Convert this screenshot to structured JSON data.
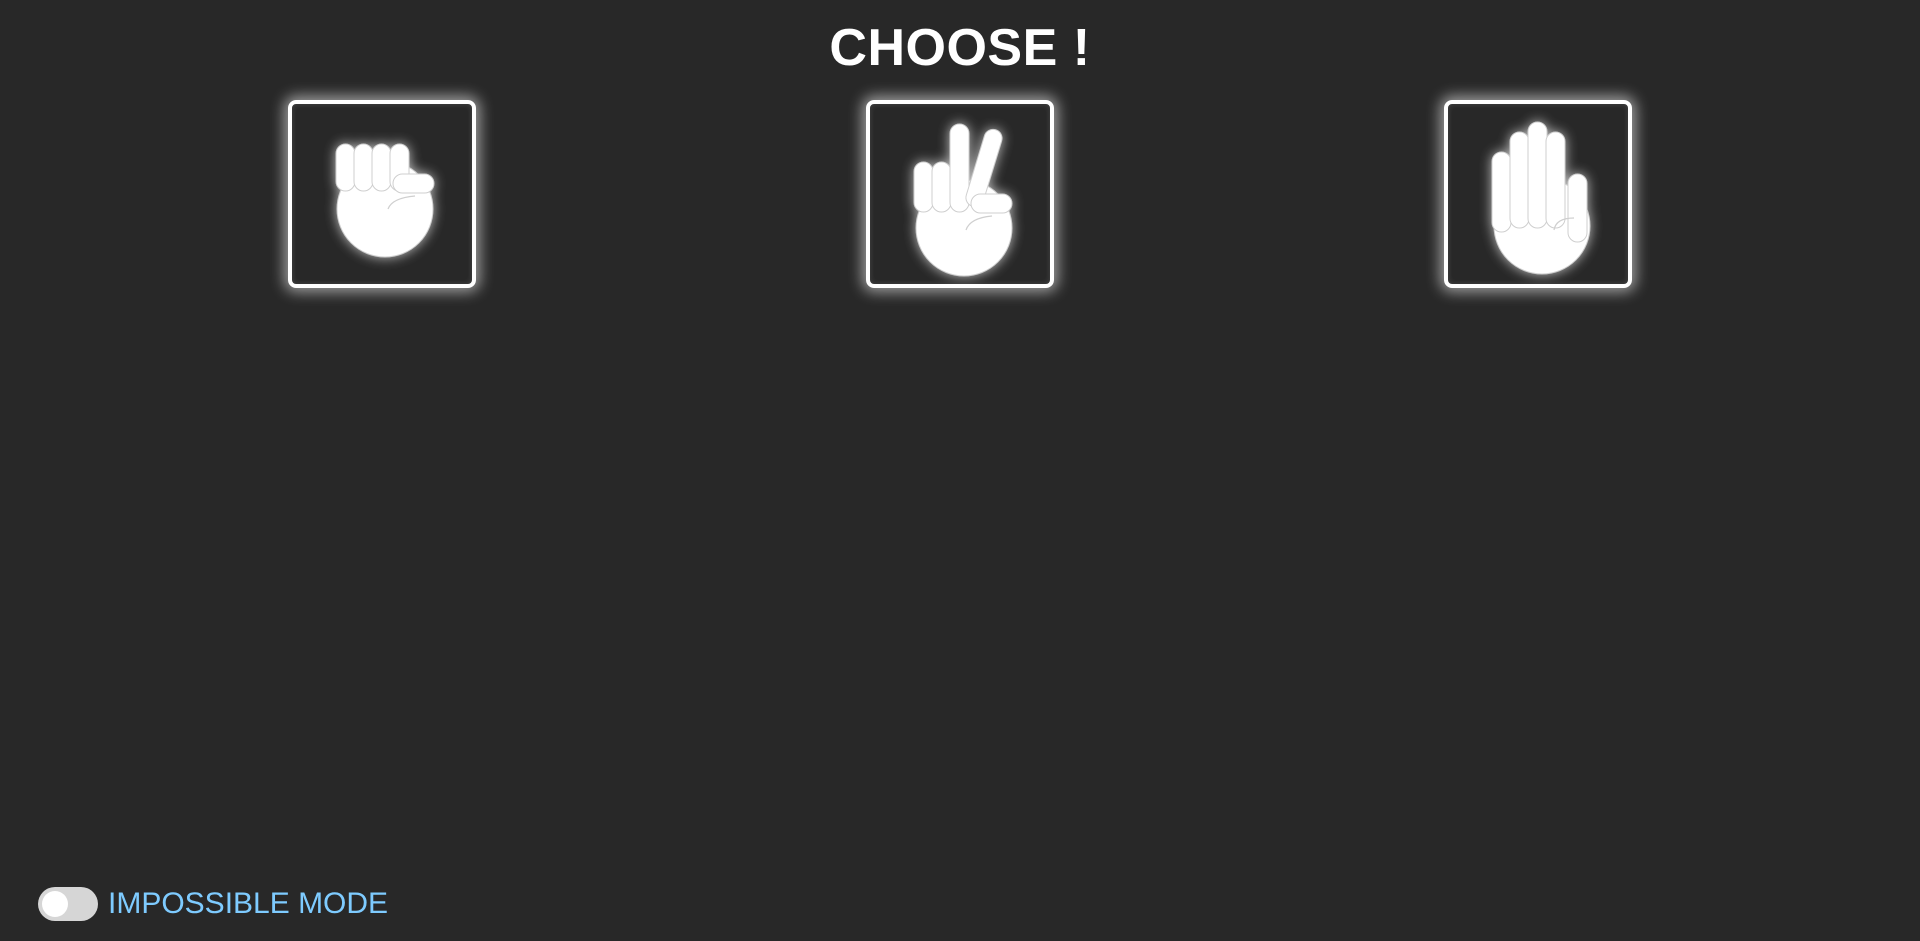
{
  "header": {
    "title": "CHOOSE !"
  },
  "choices": [
    {
      "id": "rock",
      "icon": "fist-icon"
    },
    {
      "id": "scissors",
      "icon": "peace-hand-icon"
    },
    {
      "id": "paper",
      "icon": "open-hand-icon"
    }
  ],
  "mode": {
    "label": "IMPOSSIBLE MODE",
    "enabled": false
  },
  "colors": {
    "background": "#282828",
    "foreground": "#ffffff",
    "mode_label": "#7ecbff",
    "toggle_track": "#d6d6d6"
  }
}
